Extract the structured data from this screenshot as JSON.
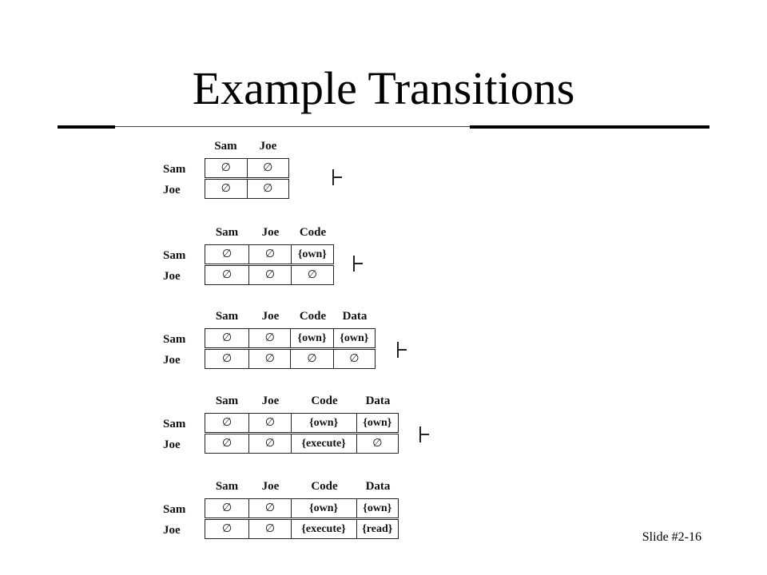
{
  "slide": {
    "title": "Example Transitions",
    "number": "Slide #2-16"
  },
  "matrices": [
    {
      "columns": [
        "Sam",
        "Joe"
      ],
      "rows": [
        {
          "label": "Sam",
          "cells": [
            "∅",
            "∅"
          ]
        },
        {
          "label": "Joe",
          "cells": [
            "∅",
            "∅"
          ]
        }
      ],
      "turnstile": true
    },
    {
      "columns": [
        "Sam",
        "Joe",
        "Code"
      ],
      "rows": [
        {
          "label": "Sam",
          "cells": [
            "∅",
            "∅",
            "{own}"
          ]
        },
        {
          "label": "Joe",
          "cells": [
            "∅",
            "∅",
            "∅"
          ]
        }
      ],
      "turnstile": true
    },
    {
      "columns": [
        "Sam",
        "Joe",
        "Code",
        "Data"
      ],
      "rows": [
        {
          "label": "Sam",
          "cells": [
            "∅",
            "∅",
            "{own}",
            "{own}"
          ]
        },
        {
          "label": "Joe",
          "cells": [
            "∅",
            "∅",
            "∅",
            "∅"
          ]
        }
      ],
      "turnstile": true
    },
    {
      "columns": [
        "Sam",
        "Joe",
        "Code",
        "Data"
      ],
      "rows": [
        {
          "label": "Sam",
          "cells": [
            "∅",
            "∅",
            "{own}",
            "{own}"
          ]
        },
        {
          "label": "Joe",
          "cells": [
            "∅",
            "∅",
            "{execute}",
            "∅"
          ]
        }
      ],
      "turnstile": true
    },
    {
      "columns": [
        "Sam",
        "Joe",
        "Code",
        "Data"
      ],
      "rows": [
        {
          "label": "Sam",
          "cells": [
            "∅",
            "∅",
            "{own}",
            "{own}"
          ]
        },
        {
          "label": "Joe",
          "cells": [
            "∅",
            "∅",
            "{execute}",
            "{read}"
          ]
        }
      ],
      "turnstile": false
    }
  ]
}
